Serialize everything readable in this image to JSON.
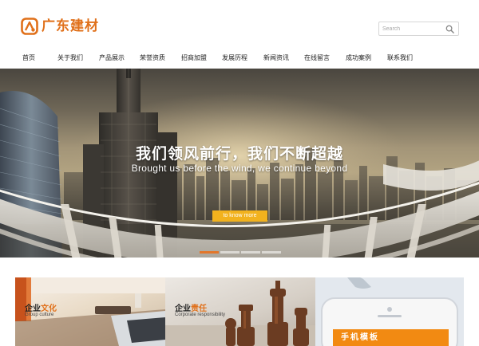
{
  "brand": {
    "logo_text": "广东建材",
    "accent": "#e0701a"
  },
  "search": {
    "placeholder": "Search"
  },
  "nav": {
    "items": [
      {
        "label": "首页"
      },
      {
        "label": "关于我们"
      },
      {
        "label": "产品展示"
      },
      {
        "label": "荣誉资质"
      },
      {
        "label": "招商加盟"
      },
      {
        "label": "发展历程"
      },
      {
        "label": "新闻资讯"
      },
      {
        "label": "在线留言"
      },
      {
        "label": "成功案例"
      },
      {
        "label": "联系我们"
      }
    ]
  },
  "banner": {
    "title": "我们领风前行，我们不断超越",
    "subtitle": "Brought us before the wind, we continue beyond",
    "button_label": "to know more",
    "button_color": "#f2b21e",
    "slides": 4,
    "active_slide": 1,
    "indicator_active_color": "#e3762a"
  },
  "cards": [
    {
      "title_prefix": "企业",
      "title_accent": "文化",
      "subtitle": "Group culture"
    },
    {
      "title_prefix": "企业",
      "title_accent": "责任",
      "subtitle": "Corporate responsibility"
    },
    {
      "phone_label": "手机模板",
      "phone_label_color": "#f28a12"
    }
  ]
}
